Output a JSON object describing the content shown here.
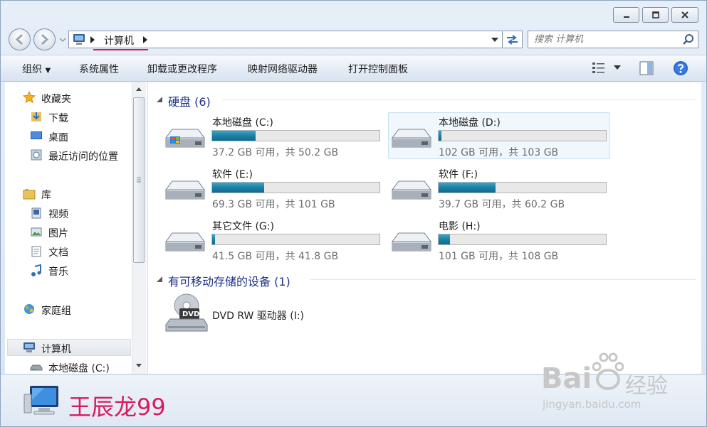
{
  "window": {
    "title_icons": [
      "minimize-icon",
      "maximize-icon",
      "close-icon"
    ]
  },
  "address": {
    "breadcrumb": "计算机"
  },
  "search": {
    "placeholder": "搜索 计算机"
  },
  "toolbar": {
    "organize": "组织",
    "system_properties": "系统属性",
    "uninstall": "卸载或更改程序",
    "map_drive": "映射网络驱动器",
    "control_panel": "打开控制面板"
  },
  "nav": {
    "favorites": {
      "label": "收藏夹",
      "items": [
        "下载",
        "桌面",
        "最近访问的位置"
      ]
    },
    "libraries": {
      "label": "库",
      "items": [
        "视频",
        "图片",
        "文档",
        "音乐"
      ]
    },
    "homegroup": "家庭组",
    "computer": "计算机",
    "computer_child": "本地磁盘 (C:)"
  },
  "hard_drives": {
    "title": "硬盘",
    "count": "(6)",
    "drives": [
      {
        "name": "本地磁盘 (C:)",
        "capacity": "37.2 GB 可用，共 50.2 GB",
        "used_fraction": 0.26
      },
      {
        "name": "本地磁盘 (D:)",
        "capacity": "102 GB 可用，共 103 GB",
        "used_fraction": 0.01
      },
      {
        "name": "软件 (E:)",
        "capacity": "69.3 GB 可用，共 101 GB",
        "used_fraction": 0.31
      },
      {
        "name": "软件 (F:)",
        "capacity": "39.7 GB 可用，共 60.2 GB",
        "used_fraction": 0.34
      },
      {
        "name": "其它文件 (G:)",
        "capacity": "41.5 GB 可用，共 41.8 GB",
        "used_fraction": 0.01
      },
      {
        "name": "电影 (H:)",
        "capacity": "101 GB 可用，共 108 GB",
        "used_fraction": 0.07
      }
    ]
  },
  "removable": {
    "title": "有可移动存储的设备",
    "count": "(1)",
    "items": [
      {
        "name": "DVD RW 驱动器 (I:)",
        "icon_label": "DVD"
      }
    ]
  },
  "details": {
    "name": "王辰龙99"
  },
  "watermark": {
    "brand": "Bai",
    "brand_suffix": "经验",
    "url": "jingyan.baidu.com"
  },
  "colors": {
    "accent": "#1e3287",
    "bar_fill": "#1d7fa4",
    "username": "#d81b60",
    "breadcrumb_underline": "#d81b60"
  }
}
